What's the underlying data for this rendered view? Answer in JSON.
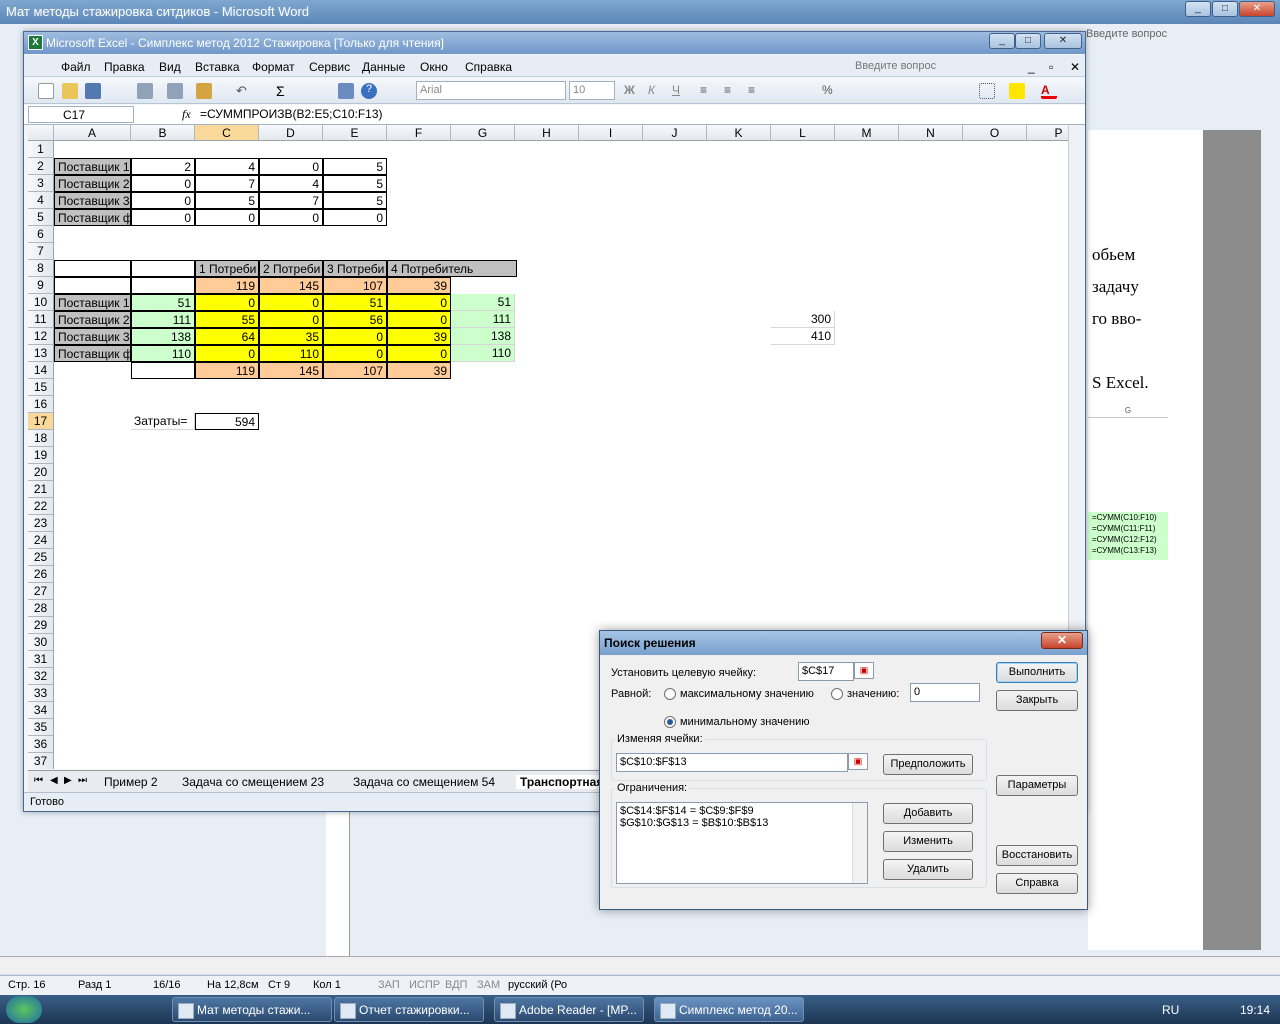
{
  "word": {
    "title": "Мат методы стажировка ситдиков - Microsoft Word",
    "help_placeholder": "Введите вопрос",
    "page_text": [
      "обьем",
      "задачу",
      "го вво-",
      "S Excel."
    ],
    "mini_formulas": [
      "=СУММ(C10:F10)",
      "=СУММ(C11:F11)",
      "=СУММ(C12:F12)",
      "=СУММ(C13:F13)"
    ],
    "mini_col": "G",
    "status": {
      "page": "Стр. 16",
      "section": "Разд 1",
      "pages": "16/16",
      "at": "На 12,8см",
      "line": "Ст 9",
      "col": "Кол 1",
      "rec": "ЗАП",
      "trk": "ИСПР",
      "ext": "ВДП",
      "ovr": "ЗАМ",
      "lang": "русский (Ро"
    }
  },
  "taskbar": {
    "items": [
      "Мат методы стажи...",
      "Отчет стажировки...",
      "Adobe Reader - [MP...",
      "Симплекс метод 20..."
    ],
    "lang": "RU",
    "time": "19:14"
  },
  "excel": {
    "title": "Microsoft Excel - Симплекс метод 2012 Стажировка  [Только для чтения]",
    "menu": [
      "Файл",
      "Правка",
      "Вид",
      "Вставка",
      "Формат",
      "Сервис",
      "Данные",
      "Окно",
      "Справка"
    ],
    "help_placeholder": "Введите вопрос",
    "font_name": "Arial",
    "font_size": "10",
    "name_box": "C17",
    "fx": "fx",
    "formula": "=СУММПРОИЗВ(B2:E5;C10:F13)",
    "columns": [
      "A",
      "B",
      "C",
      "D",
      "E",
      "F",
      "G",
      "H",
      "I",
      "J",
      "K",
      "L",
      "M",
      "N",
      "O",
      "P"
    ],
    "rows": [
      "1",
      "2",
      "3",
      "4",
      "5",
      "6",
      "7",
      "8",
      "9",
      "10",
      "11",
      "12",
      "13",
      "14",
      "15",
      "16",
      "17",
      "18",
      "19",
      "20",
      "21",
      "22",
      "23",
      "24",
      "25",
      "26",
      "27",
      "28",
      "29",
      "30",
      "31",
      "32",
      "33",
      "34",
      "35",
      "36",
      "37"
    ],
    "cells": {
      "A2": "Поставщик 1",
      "B2": "2",
      "C2": "4",
      "D2": "0",
      "E2": "5",
      "A3": "Поставщик 2",
      "B3": "0",
      "C3": "7",
      "D3": "4",
      "E3": "5",
      "A4": "Поставщик 3",
      "B4": "0",
      "C4": "5",
      "D4": "7",
      "E4": "5",
      "A5": "Поставщик ф",
      "B5": "0",
      "C5": "0",
      "D5": "0",
      "E5": "0",
      "C8": "1 Потреби",
      "D8": "2 Потреби",
      "E8": "3 Потреби",
      "F8": "4 Потребитель",
      "C9": "119",
      "D9": "145",
      "E9": "107",
      "F9": "39",
      "A10": "Поставщик 1",
      "B10": "51",
      "C10": "0",
      "D10": "0",
      "E10": "51",
      "F10": "0",
      "G10": "51",
      "A11": "Поставщик 2",
      "B11": "111",
      "C11": "55",
      "D11": "0",
      "E11": "56",
      "F11": "0",
      "G11": "111",
      "L11": "300",
      "A12": "Поставщик 3",
      "B12": "138",
      "C12": "64",
      "D12": "35",
      "E12": "0",
      "F12": "39",
      "G12": "138",
      "L12": "410",
      "A13": "Поставщик ф",
      "B13": "110",
      "C13": "0",
      "D13": "110",
      "E13": "0",
      "F13": "0",
      "G13": "110",
      "C14": "119",
      "D14": "145",
      "E14": "107",
      "F14": "39",
      "B17": "Затраты=",
      "C17": "594"
    },
    "sheet_tabs": [
      "Пример 2",
      "Задача со смещением 23",
      "Задача со смещением 54",
      "Транспортная"
    ],
    "status": "Готово"
  },
  "solver": {
    "title": "Поиск решения",
    "target_label": "Установить целевую ячейку:",
    "target_value": "$C$17",
    "equal_label": "Равной:",
    "max_label": "максимальному значению",
    "value_label": "значению:",
    "value_input": "0",
    "min_label": "минимальному значению",
    "selected": "min",
    "changing_label": "Изменяя ячейки:",
    "changing_value": "$C$10:$F$13",
    "guess_button": "Предположить",
    "constraints_label": "Ограничения:",
    "constraints": [
      "$C$14:$F$14 = $C$9:$F$9",
      "$G$10:$G$13 = $B$10:$B$13"
    ],
    "add_button": "Добавить",
    "change_button": "Изменить",
    "delete_button": "Удалить",
    "solve_button": "Выполнить",
    "close_button": "Закрыть",
    "options_button": "Параметры",
    "reset_button": "Восстановить",
    "help_button": "Справка"
  },
  "colors": {
    "gray": "#c0c0c0",
    "green": "#ccffcc",
    "yellow": "#ffff00",
    "orange": "#ffcc99"
  }
}
